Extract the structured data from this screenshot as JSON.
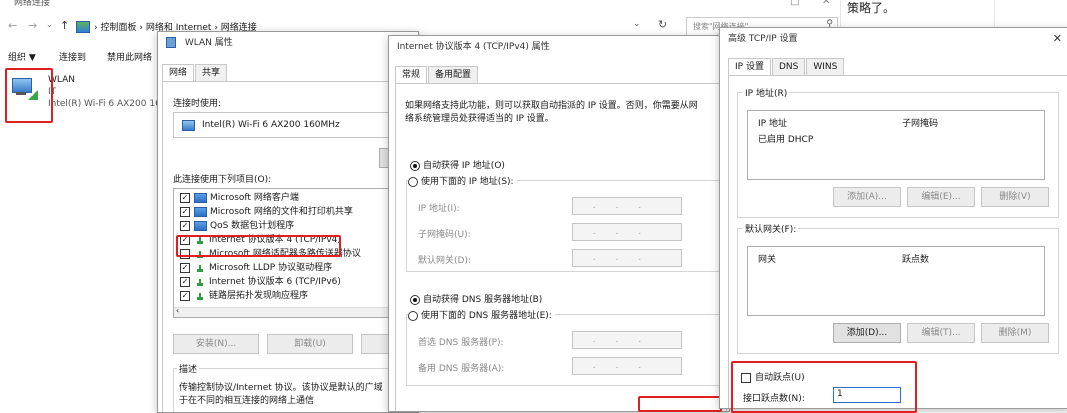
{
  "explorer": {
    "title": "网络连接",
    "breadcrumb": [
      "控制面板",
      "网络和 Internet",
      "网络连接"
    ],
    "search_placeholder": "搜索\"网络连接\"",
    "toolbar": [
      "组织 ▼",
      "连接到",
      "禁用此网络"
    ],
    "adapter": {
      "name": "WLAN",
      "sub": "IT",
      "device": "Intel(R) Wi-Fi 6 AX200 16"
    }
  },
  "note_text": "策略了。",
  "wlan": {
    "title": "WLAN 属性",
    "tabs": [
      "网络",
      "共享"
    ],
    "connect_using_label": "连接时使用:",
    "device": "Intel(R) Wi-Fi 6 AX200 160MHz",
    "items_label": "此连接使用下列项目(O):",
    "items": [
      {
        "label": "Microsoft 网络客户端",
        "checked": "✓",
        "icon": "computer"
      },
      {
        "label": "Microsoft 网络的文件和打印机共享",
        "checked": "✓",
        "icon": "computer"
      },
      {
        "label": "QoS 数据包计划程序",
        "checked": "✓",
        "icon": "computer"
      },
      {
        "label": "Internet 协议版本 4 (TCP/IPv4)",
        "checked": "✓",
        "icon": "network"
      },
      {
        "label": "Microsoft 网络适配器多路传送器协议",
        "checked": "",
        "icon": "network"
      },
      {
        "label": "Microsoft LLDP 协议驱动程序",
        "checked": "✓",
        "icon": "network"
      },
      {
        "label": "Internet 协议版本 6 (TCP/IPv6)",
        "checked": "✓",
        "icon": "network"
      },
      {
        "label": "链路层拓扑发现响应程序",
        "checked": "✓",
        "icon": "network"
      }
    ],
    "install_btn": "安装(N)...",
    "uninstall_btn": "卸载(U)",
    "description_label": "描述",
    "description_text_1": "传输控制协议/Internet 协议。该协议是默认的广域",
    "description_text_2": "于在不同的相互连接的网络上通信"
  },
  "ipv4": {
    "title": "Internet 协议版本 4 (TCP/IPv4) 属性",
    "tabs": [
      "常规",
      "备用配置"
    ],
    "intro_1": "如果网络支持此功能，则可以获取自动指派的 IP 设置。否则，你需要从网",
    "intro_2": "络系统管理员处获得适当的 IP 设置。",
    "auto_ip": "自动获得 IP 地址(O)",
    "manual_ip": "使用下面的 IP 地址(S):",
    "ip_label": "IP 地址(I):",
    "mask_label": "子网掩码(U):",
    "gateway_label": "默认网关(D):",
    "auto_dns": "自动获得 DNS 服务器地址(B)",
    "manual_dns": "使用下面的 DNS 服务器地址(E):",
    "pref_dns": "首选 DNS 服务器(P):",
    "alt_dns": "备用 DNS 服务器(A):",
    "ip_placeholder": "...",
    "ip_auto_checked": true,
    "dns_auto_checked": true
  },
  "advanced": {
    "title": "高级 TCP/IP 设置",
    "close": "✕",
    "tabs": [
      "IP 设置",
      "DNS",
      "WINS"
    ],
    "ip_group": "IP 地址(R)",
    "ip_col1": "IP 地址",
    "ip_col2": "子网掩码",
    "ip_row": "已启用 DHCP",
    "add_btn_1": "添加(A)...",
    "edit_btn_1": "编辑(E)...",
    "delete_btn_1": "删除(V)",
    "gw_group": "默认网关(F):",
    "gw_col1": "网关",
    "gw_col2": "跃点数",
    "add_btn_2": "添加(D)...",
    "edit_btn_2": "编辑(T)...",
    "delete_btn_2": "删除(M)",
    "auto_metric": "自动跃点(U)",
    "iface_metric_label": "接口跃点数(N):",
    "iface_metric_value": "1"
  }
}
